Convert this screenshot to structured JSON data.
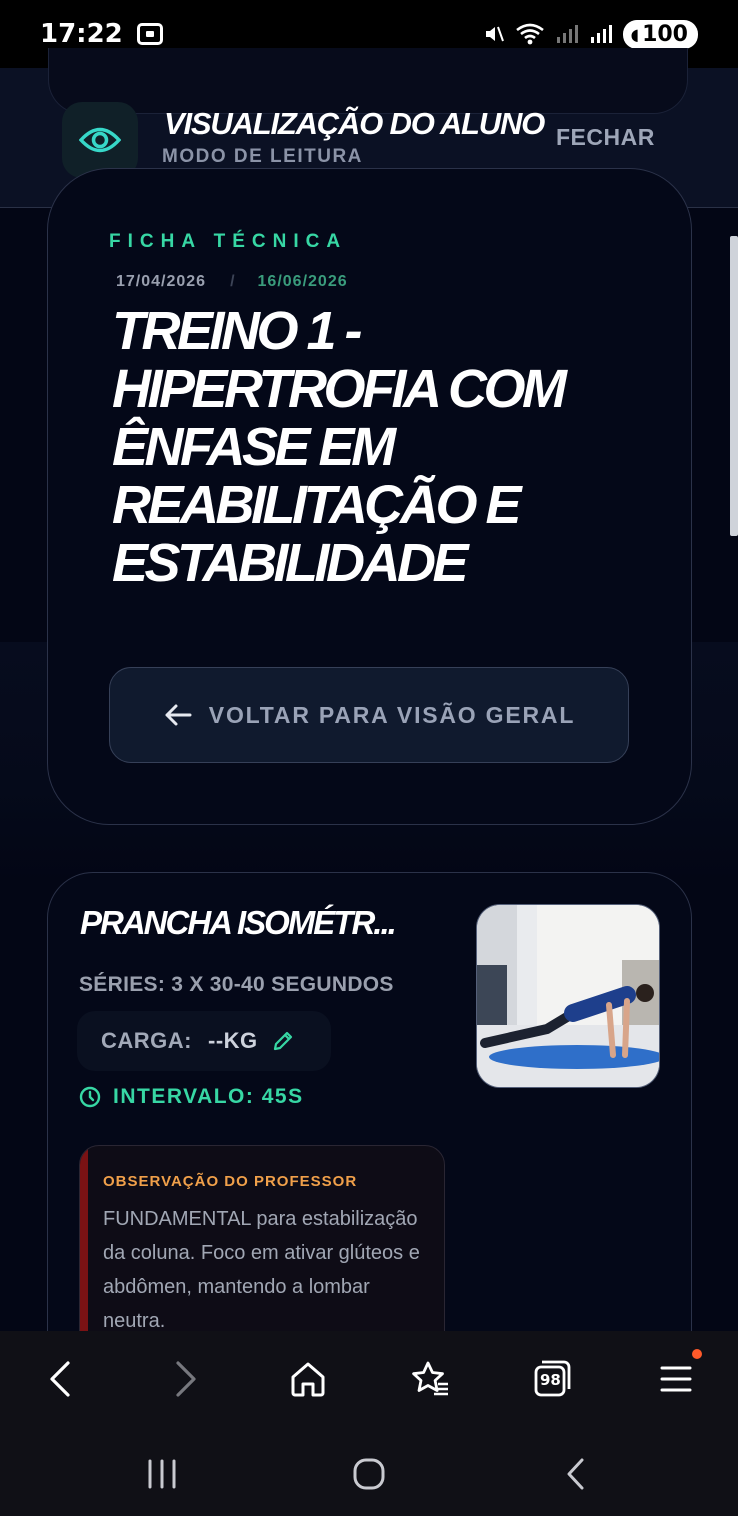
{
  "status_bar": {
    "time": "17:22",
    "battery": "100"
  },
  "header": {
    "title": "VISUALIZAÇÃO DO ALUNO",
    "subtitle": "MODO DE LEITURA",
    "close_label": "FECHAR",
    "eye_color": "#37d7c8"
  },
  "sheet": {
    "section_label": "FICHA TÉCNICA",
    "date_start": "17/04/2026",
    "date_separator": "/",
    "date_end": "16/06/2026",
    "title": "TREINO 1 - HIPERTROFIA COM ÊNFASE EM REABILITAÇÃO E ESTABILIDADE",
    "back_label": "VOLTAR PARA VISÃO GERAL"
  },
  "exercise": {
    "name": "PRANCHA ISOMÉTR...",
    "series": "SÉRIES: 3 X 30-40 SEGUNDOS",
    "load_label": "CARGA:",
    "load_value": "--KG",
    "interval": "INTERVALO: 45S",
    "note_title": "OBSERVAÇÃO DO PROFESSOR",
    "note_text": "FUNDAMENTAL para estabilização da coluna. Foco em ativar glúteos e abdômen, mantendo a lombar neutra."
  },
  "browser_bar": {
    "tabs_count": "98"
  },
  "colors": {
    "accent_green": "#37d7a4",
    "note_orange": "#f0a04a",
    "background": "#030615"
  }
}
